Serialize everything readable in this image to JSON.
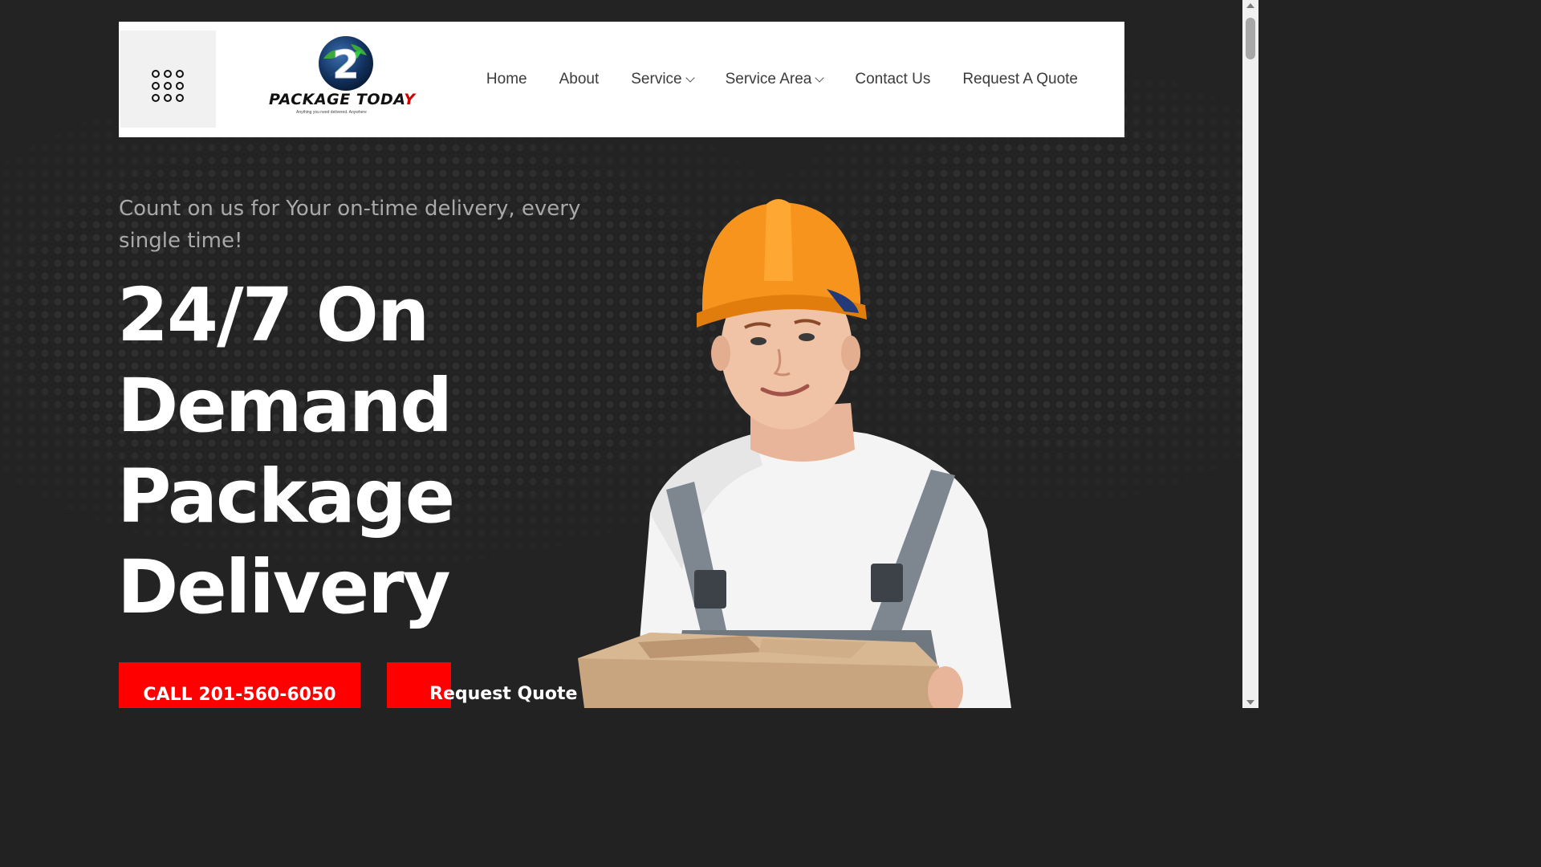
{
  "header": {
    "menu_icon": "nine-dot-grid-icon",
    "logo": {
      "numeral": "2",
      "wordmark": "PACKAGE TODAY",
      "tagline": "Anything you need delivered. Anywhere"
    },
    "nav": [
      {
        "label": "Home",
        "has_dropdown": false
      },
      {
        "label": "About",
        "has_dropdown": false
      },
      {
        "label": "Service",
        "has_dropdown": true
      },
      {
        "label": "Service Area",
        "has_dropdown": true
      },
      {
        "label": "Contact Us",
        "has_dropdown": false
      },
      {
        "label": "Request A Quote",
        "has_dropdown": false
      }
    ]
  },
  "hero": {
    "tagline": "Count on us for Your on-time delivery, every single time!",
    "headline": [
      "24/7 On",
      "Demand",
      "Package",
      "Delivery"
    ],
    "call_button": "CALL 201-560-6050",
    "quote_button": "Request Quote"
  },
  "colors": {
    "background": "#232323",
    "accent": "#ff0000",
    "header_bg": "#ffffff",
    "nav_text": "#3b3b3b",
    "helmet": "#f7941d"
  }
}
